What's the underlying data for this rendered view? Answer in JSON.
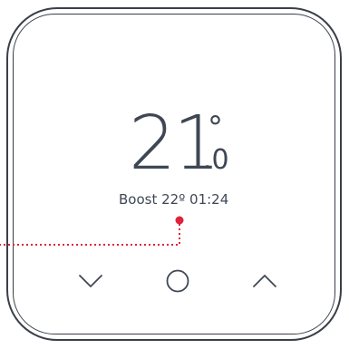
{
  "display": {
    "temperature_whole": "21",
    "temperature_degree": "°",
    "temperature_decimal": ".0",
    "status_text": "Boost 22º 01:24"
  },
  "icons": {
    "down": "chevron-down-icon",
    "mode": "circle-icon",
    "up": "chevron-up-icon"
  },
  "colors": {
    "text": "#3f4754",
    "frame": "#3a3f48",
    "callout": "#e0223a"
  }
}
